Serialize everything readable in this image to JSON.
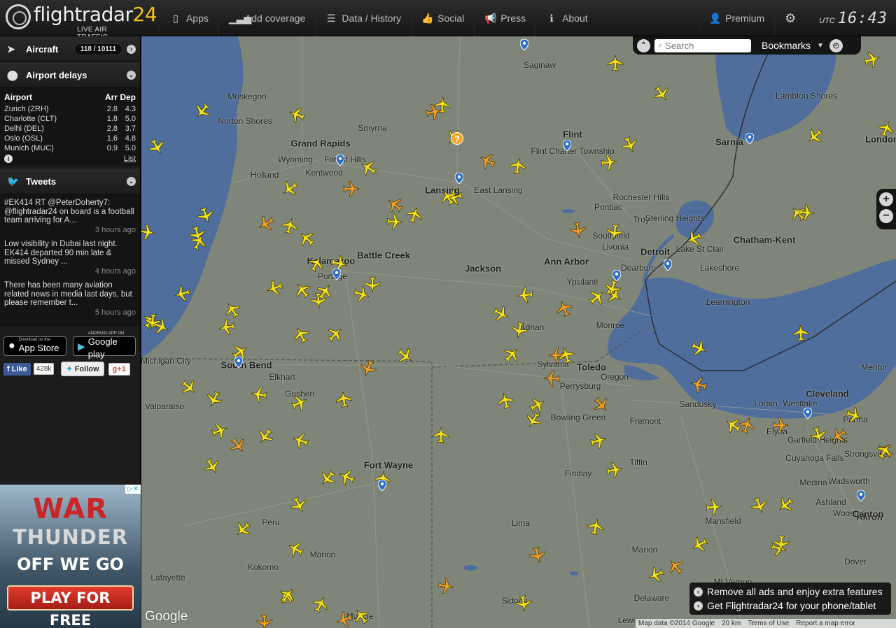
{
  "header": {
    "brand_text": "flightradar",
    "brand_num": "24",
    "tagline": "LIVE AIR TRAFFIC",
    "nav": [
      {
        "label": "Apps",
        "icon": "mobile-icon"
      },
      {
        "label": "Add coverage",
        "icon": "signal-bars-icon"
      },
      {
        "label": "Data / History",
        "icon": "database-icon"
      },
      {
        "label": "Social",
        "icon": "thumbs-up-icon"
      },
      {
        "label": "Press",
        "icon": "megaphone-icon"
      },
      {
        "label": "About",
        "icon": "info-icon"
      }
    ],
    "premium_label": "Premium",
    "utc_label": "UTC",
    "time": "16:43"
  },
  "sidebar": {
    "aircraft_label": "Aircraft",
    "aircraft_count": "118 / 10111",
    "delays_label": "Airport delays",
    "delays_columns": [
      "Airport",
      "Arr",
      "Dep"
    ],
    "delays_rows": [
      [
        "Zurich (ZRH)",
        "2.8",
        "4.3"
      ],
      [
        "Charlotte (CLT)",
        "1.8",
        "5.0"
      ],
      [
        "Delhi (DEL)",
        "2.8",
        "3.7"
      ],
      [
        "Oslo (OSL)",
        "1.6",
        "4.8"
      ],
      [
        "Munich (MUC)",
        "0.9",
        "5.0"
      ]
    ],
    "delays_link": "List",
    "tweets_label": "Tweets",
    "tweets": [
      {
        "text": "#EK414 RT @PeterDoherty7: @flightradar24 on board is a football team arriving for A...",
        "when": "3 hours ago"
      },
      {
        "text": "Low visibility in Dubai last night. EK414 departed 90 min late & missed Sydney ...",
        "when": "4 hours ago"
      },
      {
        "text": "There has been many aviation related news in media last days, but please remember t...",
        "when": "5 hours ago"
      }
    ],
    "appstore_small": "Download on the",
    "appstore_big": "App Store",
    "gplay_small": "ANDROID APP ON",
    "gplay_big": "Google play",
    "fb_like": "Like",
    "fb_count": "428k",
    "tw_follow": "Follow",
    "gplus": "g+1"
  },
  "ad": {
    "line1": "WAR",
    "line2": "THUNDER",
    "line3": "OFF WE GO",
    "cta": "PLAY FOR FREE"
  },
  "map": {
    "search_placeholder": "Search",
    "bookmarks_label": "Bookmarks",
    "promo": [
      "Remove all ads and enjoy extra features",
      "Get Flightradar24 for your phone/tablet"
    ],
    "google": "Google",
    "attribution": [
      "Map data ©2014 Google",
      "20 km",
      "Terms of Use",
      "Report a map error"
    ],
    "colors": {
      "water": "#4f6e9c",
      "land": "#7f8679",
      "plane_yellow": "#f2e21b",
      "plane_orange": "#f0a02a",
      "pin": "#2d6fc7"
    },
    "cities": [
      {
        "name": "Saginaw",
        "big": false
      },
      {
        "name": "Muskegon",
        "big": false
      },
      {
        "name": "Norton Shores",
        "big": false
      },
      {
        "name": "Grand Rapids",
        "big": true
      },
      {
        "name": "Wyoming",
        "big": false
      },
      {
        "name": "Forest Hills",
        "big": false
      },
      {
        "name": "Kentwood",
        "big": false
      },
      {
        "name": "Holland",
        "big": false
      },
      {
        "name": "Smyrna",
        "big": false
      },
      {
        "name": "Lansing",
        "big": true
      },
      {
        "name": "East Lansing",
        "big": false
      },
      {
        "name": "Flint",
        "big": true
      },
      {
        "name": "Flint Charter Township",
        "big": false
      },
      {
        "name": "Rochester Hills",
        "big": false
      },
      {
        "name": "Pontiac",
        "big": false
      },
      {
        "name": "Troy",
        "big": false
      },
      {
        "name": "Sterling Heights",
        "big": false
      },
      {
        "name": "Southfield",
        "big": false
      },
      {
        "name": "Livonia",
        "big": false
      },
      {
        "name": "Detroit",
        "big": true
      },
      {
        "name": "Lake St Clair",
        "big": false
      },
      {
        "name": "Dearborn",
        "big": false
      },
      {
        "name": "Lakeshore",
        "big": false
      },
      {
        "name": "Ann Arbor",
        "big": true
      },
      {
        "name": "Ypsilanti",
        "big": false
      },
      {
        "name": "Jackson",
        "big": true
      },
      {
        "name": "Battle Creek",
        "big": true
      },
      {
        "name": "Kalamazoo",
        "big": true
      },
      {
        "name": "Portage",
        "big": false
      },
      {
        "name": "Leamington",
        "big": false
      },
      {
        "name": "Chatham-Kent",
        "big": true
      },
      {
        "name": "Sarnia",
        "big": true
      },
      {
        "name": "Lambton Shores",
        "big": false
      },
      {
        "name": "London",
        "big": true
      },
      {
        "name": "Monroe",
        "big": false
      },
      {
        "name": "Adrian",
        "big": false
      },
      {
        "name": "Toledo",
        "big": true
      },
      {
        "name": "Sylvania",
        "big": false
      },
      {
        "name": "Oregon",
        "big": false
      },
      {
        "name": "Perrysburg",
        "big": false
      },
      {
        "name": "Sandusky",
        "big": false
      },
      {
        "name": "Bowling Green",
        "big": false
      },
      {
        "name": "Fremont",
        "big": false
      },
      {
        "name": "Michigan City",
        "big": false
      },
      {
        "name": "South Bend",
        "big": true
      },
      {
        "name": "Elkhart",
        "big": false
      },
      {
        "name": "Goshen",
        "big": false
      },
      {
        "name": "Valparaiso",
        "big": false
      },
      {
        "name": "Fort Wayne",
        "big": true
      },
      {
        "name": "Tiffin",
        "big": false
      },
      {
        "name": "Findlay",
        "big": false
      },
      {
        "name": "Lima",
        "big": false
      },
      {
        "name": "Peru",
        "big": false
      },
      {
        "name": "Marion",
        "big": false
      },
      {
        "name": "Kokomo",
        "big": false
      },
      {
        "name": "Lafayette",
        "big": false
      },
      {
        "name": "Mentor",
        "big": false
      },
      {
        "name": "Cleveland",
        "big": true
      },
      {
        "name": "Lorain",
        "big": false
      },
      {
        "name": "Westlake",
        "big": false
      },
      {
        "name": "Elyria",
        "big": false
      },
      {
        "name": "Parma",
        "big": false
      },
      {
        "name": "Garfield Heights",
        "big": false
      },
      {
        "name": "Strongsville",
        "big": false
      },
      {
        "name": "Cuyahoga Falls",
        "big": false
      },
      {
        "name": "Medina",
        "big": false
      },
      {
        "name": "Wadsworth",
        "big": false
      },
      {
        "name": "Akron",
        "big": true
      },
      {
        "name": "Ashland",
        "big": false
      },
      {
        "name": "Wooster",
        "big": false
      },
      {
        "name": "Canton",
        "big": true
      },
      {
        "name": "Mansfield",
        "big": false
      },
      {
        "name": "Marion",
        "big": false
      },
      {
        "name": "Delaware",
        "big": false
      },
      {
        "name": "Dover",
        "big": false
      },
      {
        "name": "Mt Vernon",
        "big": false
      },
      {
        "name": "Sidney",
        "big": false
      },
      {
        "name": "Lewis",
        "big": false
      },
      {
        "name": "Muncie",
        "big": false
      }
    ]
  }
}
